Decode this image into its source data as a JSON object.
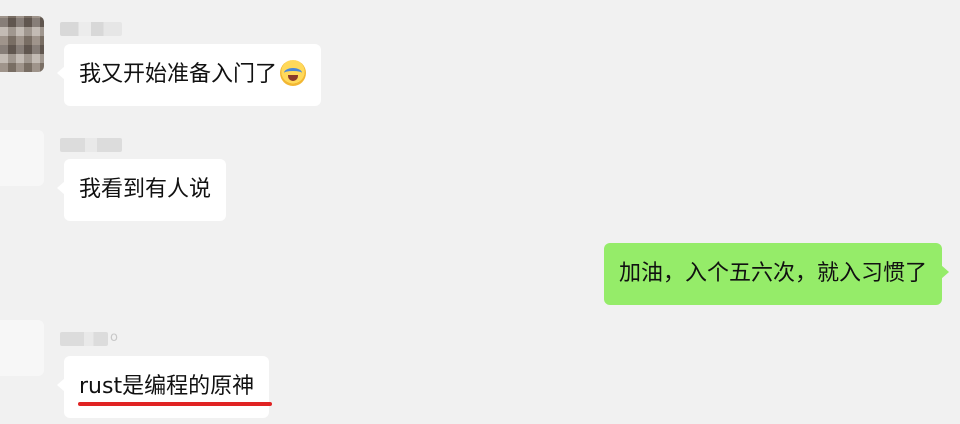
{
  "messages": [
    {
      "text": "我又开始准备入门了",
      "emoji": "crying-laughing-face-icon"
    },
    {
      "text": "我看到有人说"
    },
    {
      "text": "加油，入个五六次，就入习惯了"
    },
    {
      "text": "rust是编程的原神"
    }
  ],
  "senders": {
    "third_suffix": "o"
  },
  "colors": {
    "background": "#f1f1f1",
    "incoming_bubble": "#ffffff",
    "outgoing_bubble": "#95ec69",
    "underline": "#e02323"
  }
}
